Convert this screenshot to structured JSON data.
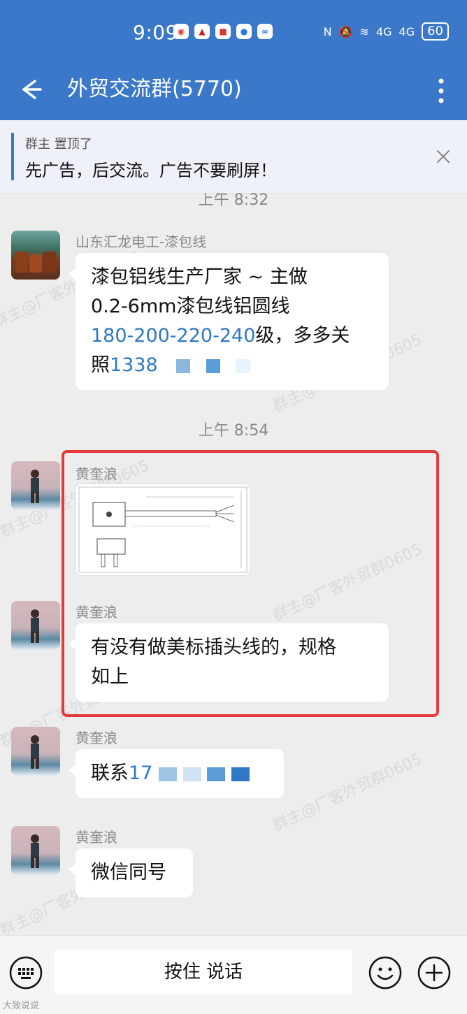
{
  "status": {
    "time": "9:09",
    "battery": "60",
    "signal1": "4G",
    "signal2": "4G"
  },
  "header": {
    "title": "外贸交流群(5770)"
  },
  "pinned": {
    "meta": "群主 置顶了",
    "text": "先广告，后交流。广告不要刷屏！"
  },
  "messages": [
    {
      "timestamp": "上午 8:32"
    },
    {
      "sender": "山东汇龙电工-漆包线",
      "lines": [
        "漆包铝线生产厂家 ~ 主做",
        "0.2-6mm漆包线铝圆线"
      ],
      "link_part": "180-200-220-240",
      "after_link": "级，多多关",
      "prefix": "照",
      "phone_link": "1338"
    },
    {
      "timestamp": "上午 8:54"
    },
    {
      "sender": "黄奎浪",
      "kind": "image"
    },
    {
      "sender": "黄奎浪",
      "lines": [
        "有没有做美标插头线的，规格",
        "如上"
      ]
    },
    {
      "sender": "黄奎浪",
      "prefix": "联系",
      "phone_link": "17"
    },
    {
      "sender": "黄奎浪",
      "lines": [
        "微信同号"
      ]
    }
  ],
  "watermark": "群主@厂客外贸群0605",
  "input": {
    "voice_label": "按住 说话"
  },
  "footer": {
    "logo": "大致说说"
  },
  "colors": {
    "accent": "#3b78c9",
    "link": "#2f78c4",
    "highlight": "#e33b3b"
  }
}
